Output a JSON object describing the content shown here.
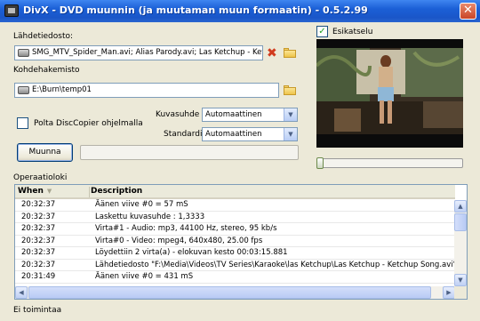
{
  "window": {
    "title": "DivX - DVD muunnin (ja muutaman muun formaatin) - 0.5.2.99",
    "close_label": "✕"
  },
  "source": {
    "label": "Lähdetiedosto:",
    "value": "SMG_MTV_Spider_Man.avi; Alias Parody.avi; Las Ketchup - Ket",
    "icon": "file-icon"
  },
  "target": {
    "label": "Kohdehakemisto",
    "value": "E:\\Burn\\temp01",
    "icon": "folder-icon"
  },
  "burn": {
    "label": "Polta DiscCopier ohjelmalla",
    "checked": false
  },
  "aspect": {
    "label": "Kuvasuhde",
    "value": "Automaattinen"
  },
  "standard": {
    "label": "Standardi",
    "value": "Automaattinen"
  },
  "convert_button": "Muunna",
  "preview": {
    "label": "Esikatselu",
    "checked": true,
    "position": 0.0
  },
  "log": {
    "label": "Operaatioloki",
    "columns": [
      "When",
      "Description"
    ],
    "rows": [
      {
        "when": "20:32:37",
        "desc": "Äänen viive #0 = 57 mS"
      },
      {
        "when": "20:32:37",
        "desc": "Laskettu kuvasuhde : 1,3333"
      },
      {
        "when": "20:32:37",
        "desc": "Virta#1 - Audio: mp3, 44100 Hz, stereo, 95 kb/s"
      },
      {
        "when": "20:32:37",
        "desc": "Virta#0 - Video: mpeg4, 640x480, 25.00 fps"
      },
      {
        "when": "20:32:37",
        "desc": "Löydettiin 2 virta(a) - elokuvan kesto 00:03:15.881"
      },
      {
        "when": "20:32:37",
        "desc": "Lähdetiedosto \"F:\\Media\\Videos\\TV Series\\Karaoke\\las Ketchup\\Las Ketchup - Ketchup Song.avi\""
      },
      {
        "when": "20:31:49",
        "desc": "Äänen viive #0 = 431 mS"
      }
    ]
  },
  "status": "Ei toimintaa",
  "colors": {
    "titlebar": "#1b5fd6",
    "checkmark": "#21a121",
    "delete": "#d13b1e"
  }
}
